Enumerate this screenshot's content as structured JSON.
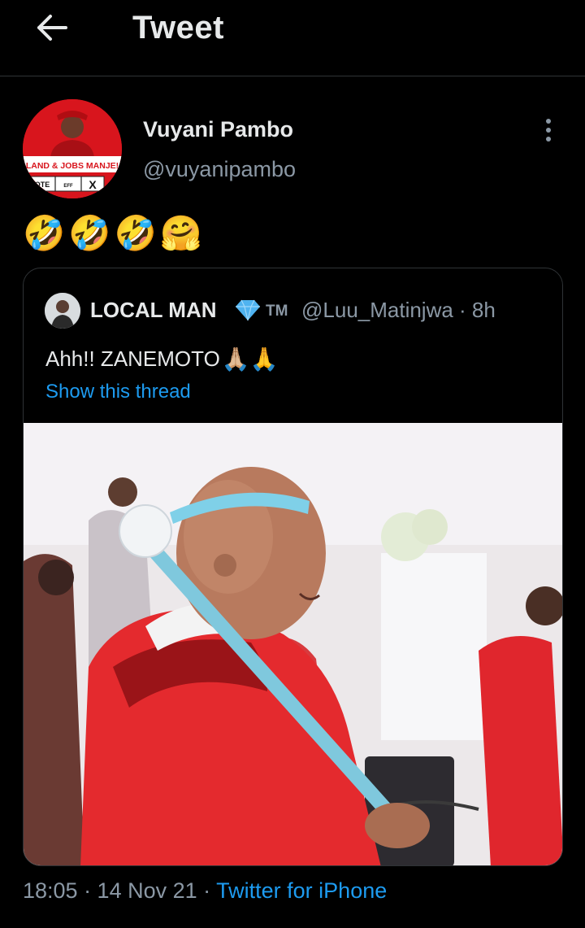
{
  "header": {
    "title": "Tweet",
    "back_icon": "arrow-left-icon"
  },
  "author": {
    "name": "Vuyani Pambo",
    "handle": "@vuyanipambo",
    "avatar_caption": "LAND & JOBS MANJE!",
    "avatar_ballot": [
      "OTE",
      "EFF",
      "X"
    ]
  },
  "tweet": {
    "emojis": [
      "🤣",
      "🤣",
      "🤣",
      "🤗"
    ]
  },
  "quoted": {
    "name": "LOCAL MAN",
    "tm": "TM",
    "meta": "@Luu_Matinjwa · 8h",
    "text": "Ahh!! ZANEMOTO",
    "hands": "🙏🏼🙏",
    "show_thread": "Show this thread"
  },
  "footer": {
    "time": "18:05 · 14 Nov 21 · ",
    "source": "Twitter for iPhone"
  },
  "colors": {
    "background": "#000000",
    "link": "#1d9bf0",
    "muted": "#8b98a5",
    "text": "#e7e9ea",
    "border": "#2f3336"
  }
}
